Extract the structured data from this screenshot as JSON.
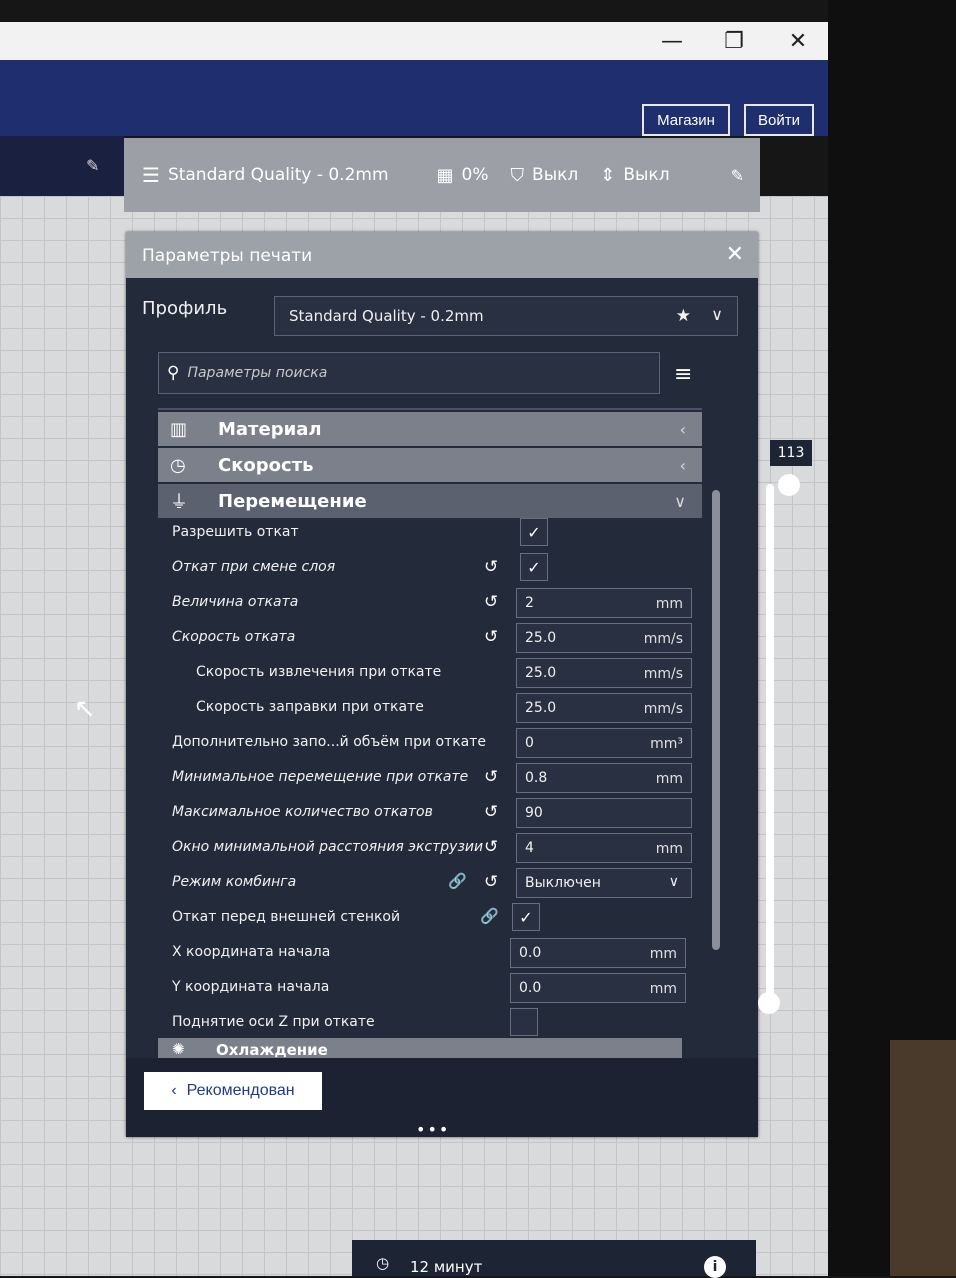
{
  "window": {
    "minimize": "—",
    "maximize": "❐",
    "close": "✕"
  },
  "header": {
    "marketplace_label": "Магазин",
    "signin_label": "Войти"
  },
  "summary": {
    "profile": "Standard Quality - 0.2mm",
    "infill": "0%",
    "support": "Выкл",
    "adhesion": "Выкл"
  },
  "panel": {
    "title": "Параметры печати",
    "profile_label": "Профиль",
    "profile_value": "Standard Quality - 0.2mm",
    "search_placeholder": "Параметры поиска",
    "categories": [
      {
        "label": "Материал"
      },
      {
        "label": "Скорость"
      },
      {
        "label": "Перемещение"
      }
    ],
    "next_category": "Охлаждение",
    "rows": [
      {
        "label": "Разрешить откат",
        "checked": true
      },
      {
        "label": "Откат при смене слоя",
        "checked": true
      },
      {
        "label": "Величина отката",
        "value": "2",
        "unit": "mm"
      },
      {
        "label": "Скорость отката",
        "value": "25.0",
        "unit": "mm/s"
      },
      {
        "label": "Скорость извлечения при откате",
        "value": "25.0",
        "unit": "mm/s"
      },
      {
        "label": "Скорость заправки при откате",
        "value": "25.0",
        "unit": "mm/s"
      },
      {
        "label": "Дополнительно запо...й объём при откате",
        "value": "0",
        "unit": "mm³"
      },
      {
        "label": "Минимальное перемещение при откате",
        "value": "0.8",
        "unit": "mm"
      },
      {
        "label": "Максимальное количество откатов",
        "value": "90",
        "unit": ""
      },
      {
        "label": "Окно минимальной расстояния экструзии",
        "value": "4",
        "unit": "mm"
      },
      {
        "label": "Режим комбинга",
        "value": "Выключен"
      },
      {
        "label": "Откат перед внешней стенкой",
        "checked": true
      },
      {
        "label": "X координата начала",
        "value": "0.0",
        "unit": "mm"
      },
      {
        "label": "Y координата начала",
        "value": "0.0",
        "unit": "mm"
      },
      {
        "label": "Поднятие оси Z при откате",
        "checked": false
      }
    ],
    "recommended_label": "Рекомендован"
  },
  "layer_slider": {
    "value": "113"
  },
  "time_estimate": "12 минут"
}
